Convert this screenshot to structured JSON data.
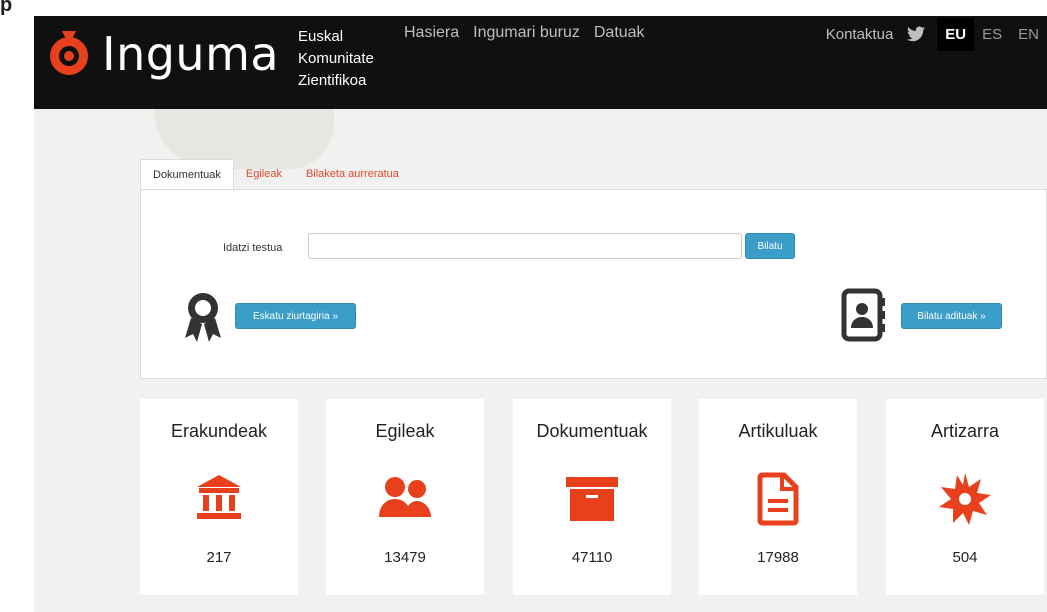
{
  "header": {
    "logo_text": "Inguma",
    "tagline": [
      "Euskal",
      "Komunitate",
      "Zientifikoa"
    ],
    "nav": [
      "Hasiera",
      "Ingumari buruz",
      "Datuak"
    ],
    "contact": "Kontaktua",
    "languages": [
      {
        "code": "EU",
        "active": true
      },
      {
        "code": "ES",
        "active": false
      },
      {
        "code": "EN",
        "active": false
      }
    ]
  },
  "search": {
    "tabs": [
      "Dokumentuak",
      "Egileak",
      "Bilaketa aurreratua"
    ],
    "label": "Idatzi testua",
    "input_value": "",
    "search_button": "Bilatu",
    "certificate_button": "Eskatu ziurtagiria »",
    "experts_button": "Bilatu adituak »"
  },
  "stats": [
    {
      "title": "Erakundeak",
      "value": "217",
      "icon": "institution-icon"
    },
    {
      "title": "Egileak",
      "value": "13479",
      "icon": "users-icon"
    },
    {
      "title": "Dokumentuak",
      "value": "47110",
      "icon": "archive-icon"
    },
    {
      "title": "Artikuluak",
      "value": "17988",
      "icon": "document-icon"
    },
    {
      "title": "Artizarra",
      "value": "504",
      "icon": "starburst-icon"
    }
  ],
  "colors": {
    "accent": "#e8401c",
    "button_blue": "#3a9ec9",
    "navbar": "#101010"
  }
}
